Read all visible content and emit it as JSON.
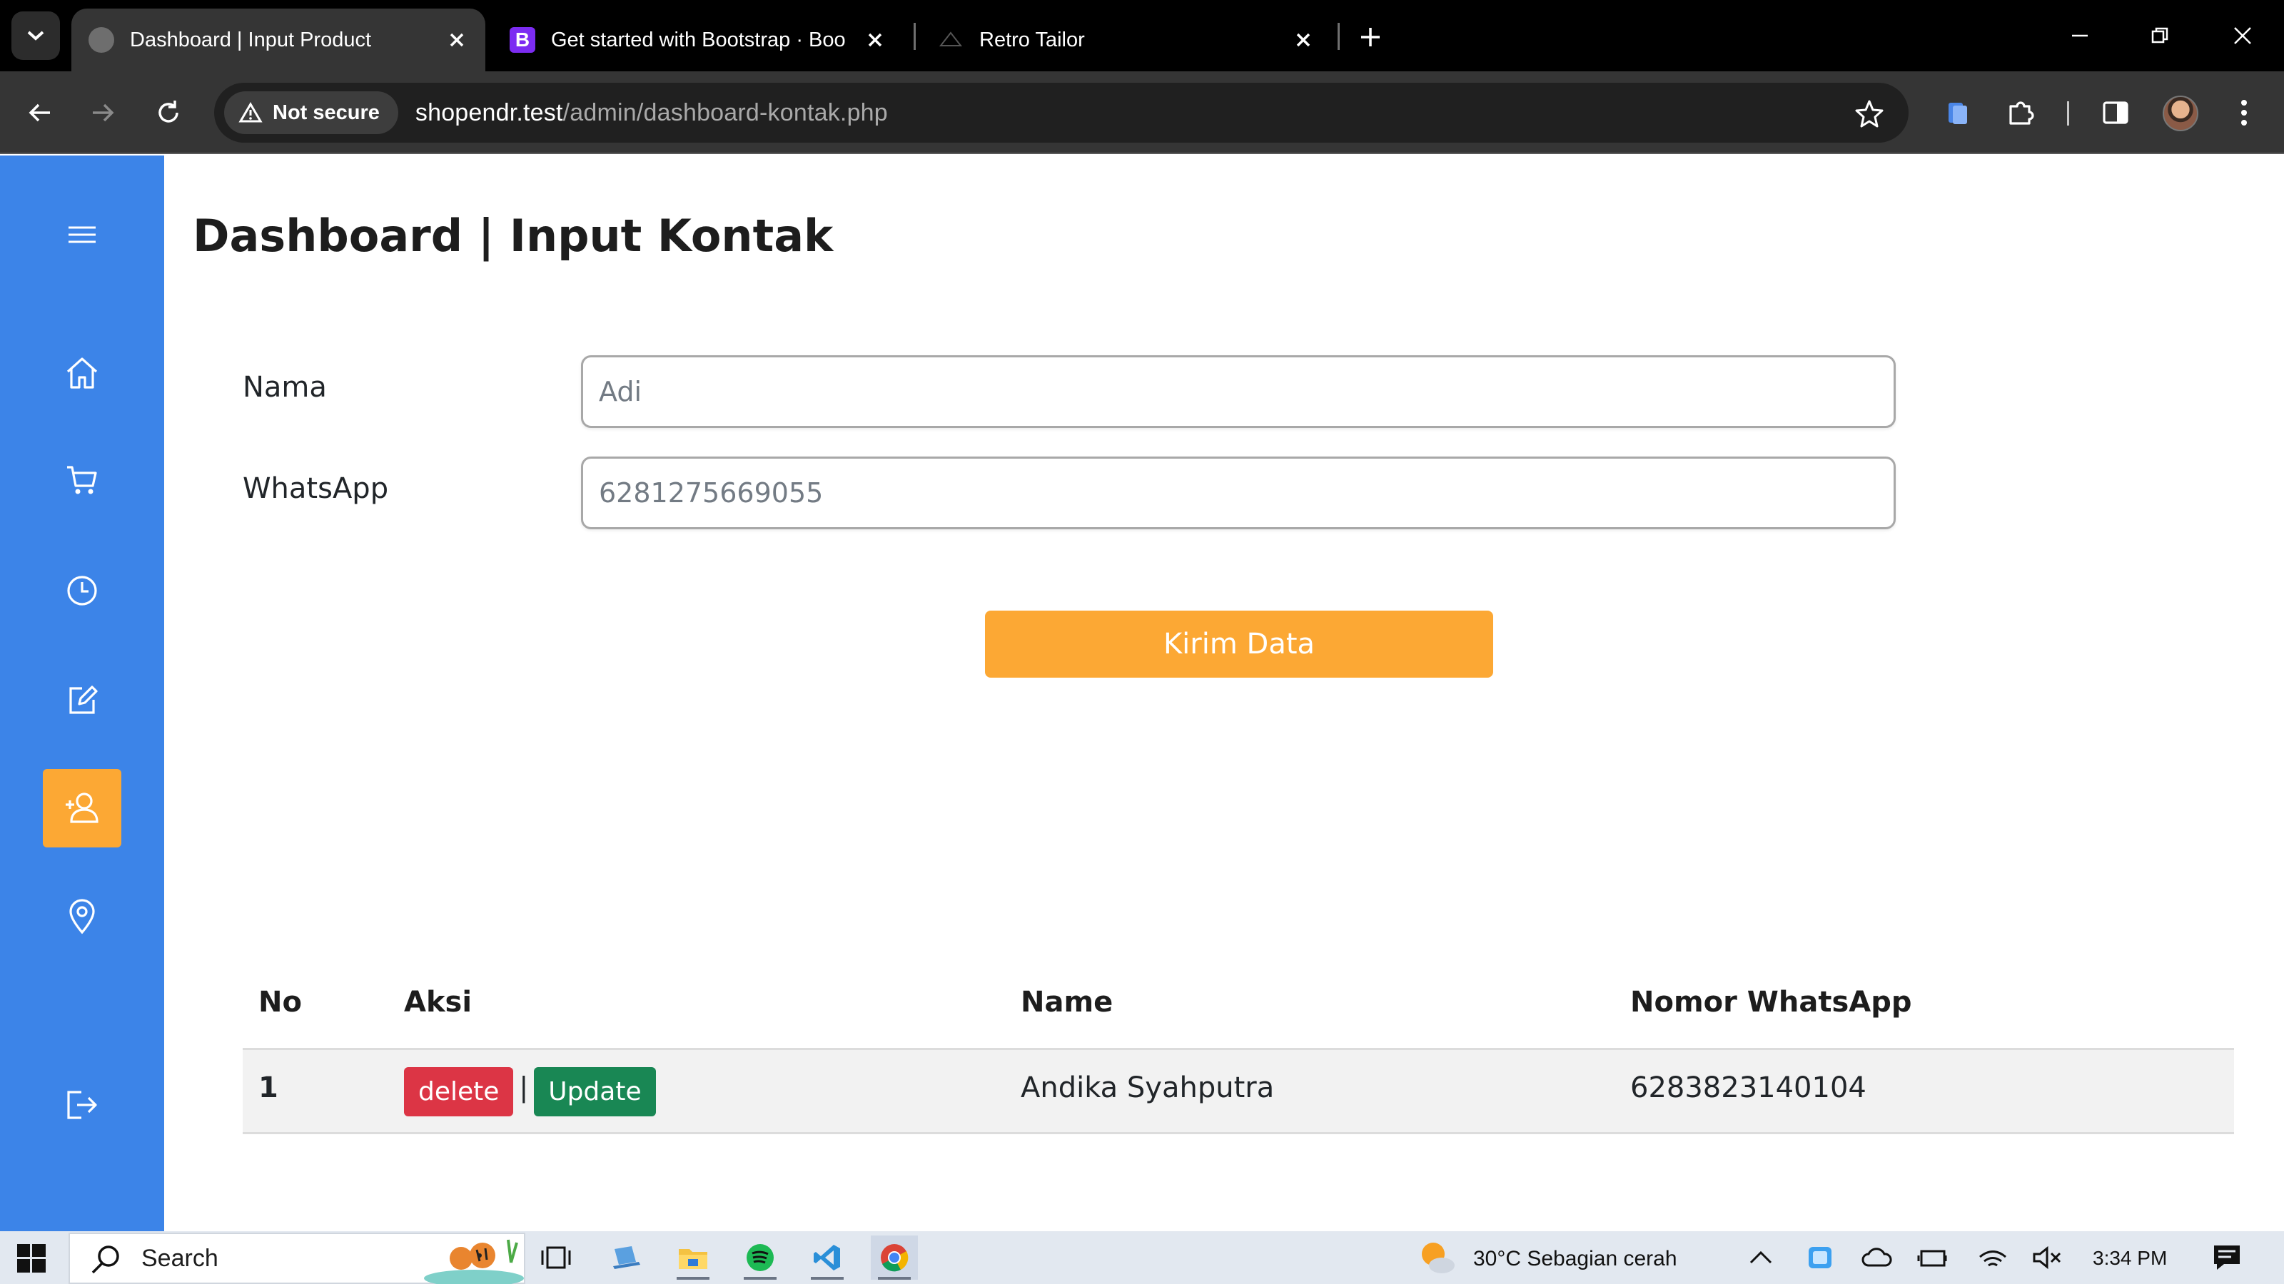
{
  "browser": {
    "tabs": [
      {
        "title": "Dashboard | Input Product",
        "active": true
      },
      {
        "title": "Get started with Bootstrap · Boo",
        "active": false
      },
      {
        "title": "Retro Tailor",
        "active": false
      }
    ],
    "security_label": "Not secure",
    "url_host": "shopendr.test",
    "url_path": "/admin/dashboard-kontak.php"
  },
  "sidebar": {
    "items": [
      {
        "icon": "menu-icon"
      },
      {
        "icon": "home-icon"
      },
      {
        "icon": "cart-icon"
      },
      {
        "icon": "clock-icon"
      },
      {
        "icon": "edit-icon"
      },
      {
        "icon": "add-user-icon",
        "active": true
      },
      {
        "icon": "location-icon"
      },
      {
        "icon": "logout-icon"
      }
    ],
    "accent_color": "#3c84e8",
    "active_color": "#fca834"
  },
  "page": {
    "title": "Dashboard | Input Kontak"
  },
  "form": {
    "nama_label": "Nama",
    "nama_placeholder": "Adi",
    "whatsapp_label": "WhatsApp",
    "whatsapp_placeholder": "6281275669055",
    "submit_label": "Kirim Data"
  },
  "table": {
    "headers": {
      "no": "No",
      "aksi": "Aksi",
      "name": "Name",
      "whatsapp": "Nomor WhatsApp"
    },
    "rows": [
      {
        "no": "1",
        "delete_label": "delete",
        "separator": "|",
        "update_label": "Update",
        "name": "Andika Syahputra",
        "whatsapp": "6283823140104"
      }
    ]
  },
  "taskbar": {
    "search_label": "Search",
    "weather": "30°C  Sebagian cerah",
    "time": "3:34 PM"
  }
}
